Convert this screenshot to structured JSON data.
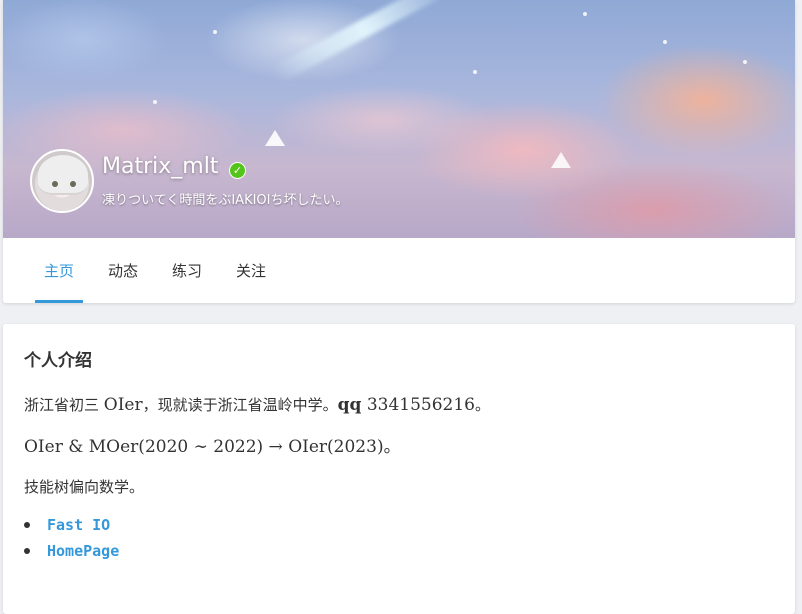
{
  "profile": {
    "username": "Matrix_mlt",
    "verified_icon": "check-badge-icon",
    "slogan": "凍りついてく時間をぶIAKIOIち坏したい。",
    "avatar_icon": "anime-avatar"
  },
  "tabs": [
    {
      "label": "主页",
      "active": true
    },
    {
      "label": "动态",
      "active": false
    },
    {
      "label": "练习",
      "active": false
    },
    {
      "label": "关注",
      "active": false
    }
  ],
  "intro": {
    "title": "个人介绍",
    "line1_prefix": "浙江省初三 ",
    "line1_oier": "OIer",
    "line1_mid": "，现就读于浙江省温岭中学。",
    "line1_qq_label": "qq",
    "line1_qq_value": " 3341556216",
    "line1_end": "。",
    "line2": "OIer & MOer(2020 ∼ 2022) → OIer(2023)。",
    "line3": "技能树偏向数学。",
    "links": [
      {
        "label": "Fast IO"
      },
      {
        "label": "HomePage"
      }
    ]
  },
  "colors": {
    "accent": "#3498db",
    "verified": "#52c41a"
  }
}
